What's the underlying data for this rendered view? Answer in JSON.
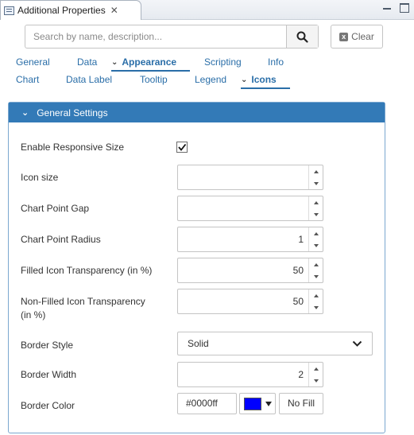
{
  "window": {
    "tab_title": "Additional Properties",
    "close_symbol": "✕",
    "tab_icon": "properties-icon"
  },
  "search": {
    "placeholder": "Search by name, description...",
    "value": "",
    "clear_label": "Clear"
  },
  "tabs_row1": [
    {
      "label": "General",
      "active": false
    },
    {
      "label": "Data",
      "active": false
    },
    {
      "label": "Appearance",
      "active": true
    },
    {
      "label": "Scripting",
      "active": false
    },
    {
      "label": "Info",
      "active": false
    }
  ],
  "tabs_row2": [
    {
      "label": "Chart",
      "active": false
    },
    {
      "label": "Data Label",
      "active": false
    },
    {
      "label": "Tooltip",
      "active": false
    },
    {
      "label": "Legend",
      "active": false
    },
    {
      "label": "Icons",
      "active": true
    }
  ],
  "group": {
    "title": "General Settings",
    "accent_color": "#337ab7"
  },
  "fields": {
    "responsive": {
      "label": "Enable Responsive Size",
      "checked": true
    },
    "icon_size": {
      "label": "Icon size",
      "value": ""
    },
    "point_gap": {
      "label": "Chart Point Gap",
      "value": ""
    },
    "point_radius": {
      "label": "Chart Point Radius",
      "value": "1"
    },
    "filled_transparency": {
      "label": "Filled Icon Transparency (in %)",
      "value": "50"
    },
    "nonfilled_transparency": {
      "label_line1": "Non-Filled Icon Transparency",
      "label_line2": "(in %)",
      "value": "50"
    },
    "border_style": {
      "label": "Border Style",
      "value": "Solid"
    },
    "border_width": {
      "label": "Border Width",
      "value": "2"
    },
    "border_color": {
      "label": "Border Color",
      "value": "#0000ff",
      "swatch": "#0000ff",
      "nofill_label": "No Fill"
    }
  }
}
